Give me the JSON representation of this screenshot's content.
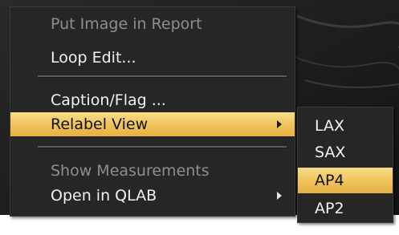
{
  "menu": {
    "items": [
      {
        "label": "Put Image in Report",
        "enabled": false,
        "highlighted": false,
        "submenu": false
      },
      {
        "label": "Loop Edit...",
        "enabled": true,
        "highlighted": false,
        "submenu": false
      },
      {
        "label": "Caption/Flag ...",
        "enabled": true,
        "highlighted": false,
        "submenu": false
      },
      {
        "label": "Relabel View",
        "enabled": true,
        "highlighted": true,
        "submenu": true
      },
      {
        "label": "Show Measurements",
        "enabled": false,
        "highlighted": false,
        "submenu": false
      },
      {
        "label": "Open in QLAB",
        "enabled": true,
        "highlighted": false,
        "submenu": true
      }
    ]
  },
  "submenu": {
    "items": [
      {
        "label": "LAX",
        "highlighted": false
      },
      {
        "label": "SAX",
        "highlighted": false
      },
      {
        "label": "AP4",
        "highlighted": true
      },
      {
        "label": "AP2",
        "highlighted": false
      }
    ]
  },
  "colors": {
    "menu_background": "#262626",
    "highlight": "#efc258",
    "disabled_text": "#8e8e8e",
    "text": "#f2f2f2"
  }
}
